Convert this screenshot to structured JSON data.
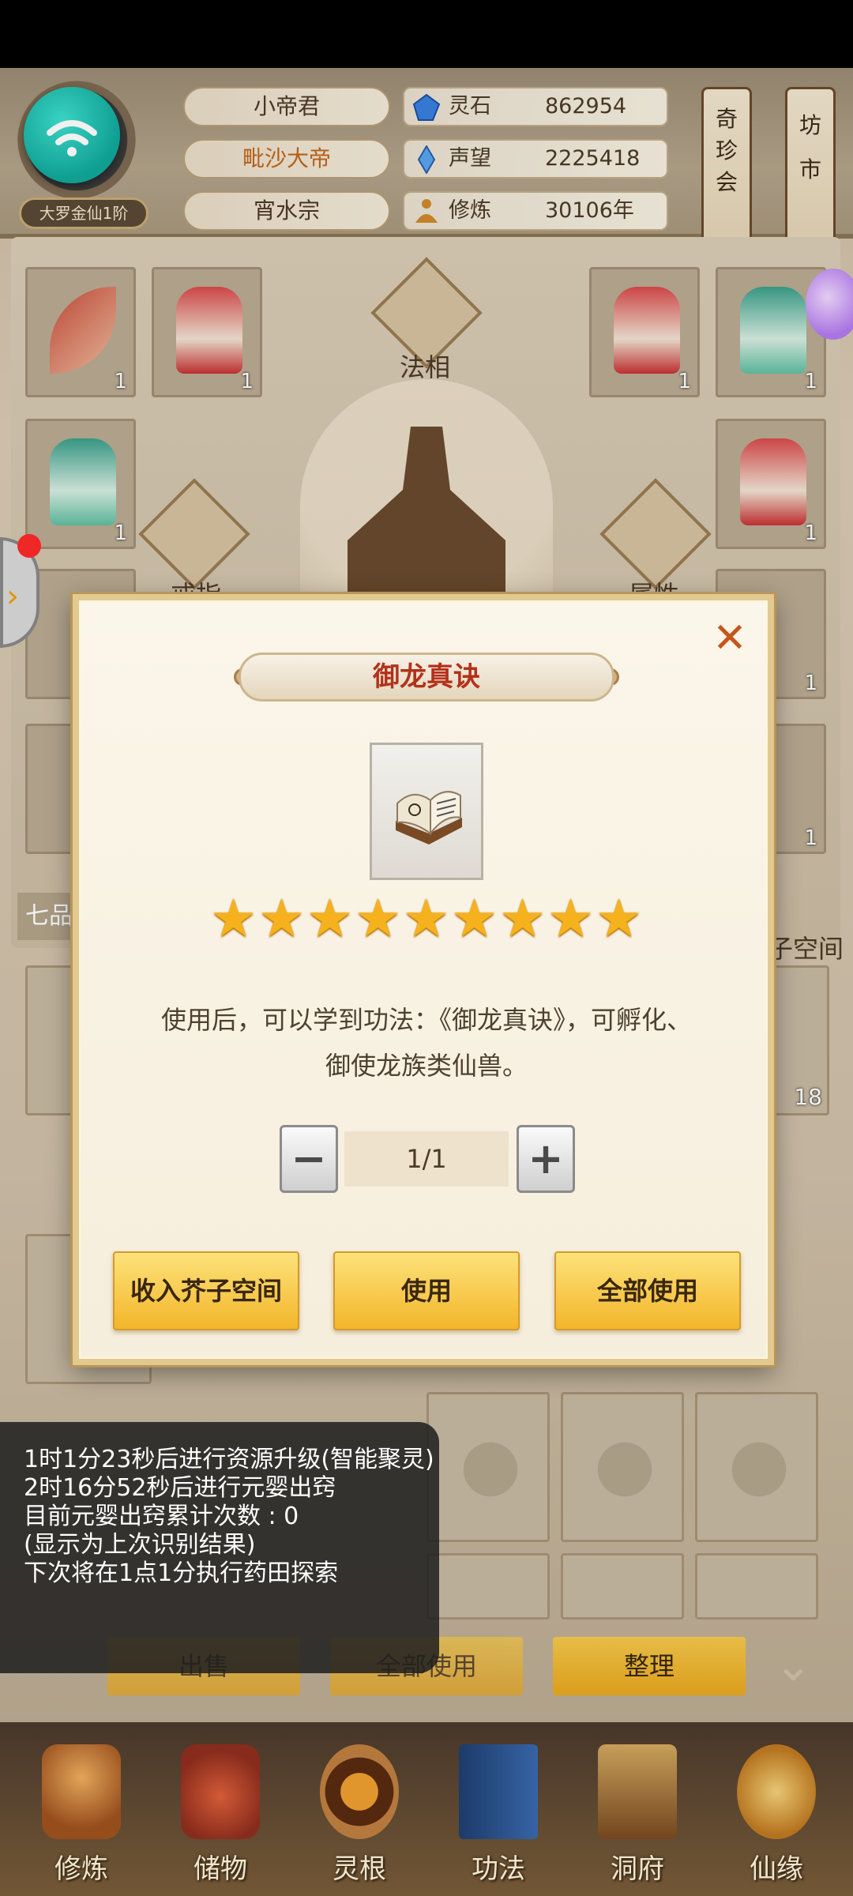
{
  "player": {
    "name": "小帝君",
    "title": "毗沙大帝",
    "sect": "宵水宗",
    "rank": "大罗金仙1阶"
  },
  "resources": [
    {
      "label": "灵石",
      "value": "862954",
      "icon": "spirit-stone-icon"
    },
    {
      "label": "声望",
      "value": "2225418",
      "icon": "reputation-crystal-icon"
    },
    {
      "label": "修炼",
      "value": "30106年",
      "icon": "meditation-icon"
    }
  ],
  "top_buttons": {
    "treasure_fair": "奇珍会",
    "market": "坊市"
  },
  "equipment": {
    "faxiang_label": "法相",
    "ring_label": "戒指",
    "mount_label": "属性",
    "quality_tag": "七品",
    "space_label": "子空间",
    "counts": [
      "1",
      "1",
      "1",
      "1",
      "1",
      "1",
      "1",
      "1",
      "18"
    ]
  },
  "modal": {
    "title": "御龙真诀",
    "stars": 9,
    "description_line1": "使用后，可以学到功法：《御龙真诀》，可孵化、",
    "description_line2": "御使龙族类仙兽。",
    "quantity": "1/1",
    "decrement": "−",
    "increment": "+",
    "close": "✕",
    "buttons": {
      "store": "收入芥子空间",
      "use": "使用",
      "use_all": "全部使用"
    }
  },
  "bag_actions": {
    "sell": "出售",
    "use_all": "全部使用",
    "sort": "整理"
  },
  "log": [
    "1时1分23秒后进行资源升级(智能聚灵)",
    "2时16分52秒后进行元婴出窍",
    "目前元婴出窍累计次数 : 0",
    "(显示为上次识别结果)",
    "下次将在1点1分执行药田探索"
  ],
  "nav": [
    {
      "label": "修炼",
      "icon": "cultivation-icon"
    },
    {
      "label": "储物",
      "icon": "storage-bag-icon"
    },
    {
      "label": "灵根",
      "icon": "spirit-root-icon"
    },
    {
      "label": "功法",
      "icon": "technique-book-icon"
    },
    {
      "label": "洞府",
      "icon": "cave-dwelling-icon"
    },
    {
      "label": "仙缘",
      "icon": "immortal-fate-icon"
    }
  ],
  "colors": {
    "modal_title": "#b3311b",
    "star": "#f6b21c",
    "button_gold": "#f3b62a",
    "wifi_teal": "#10a89a"
  }
}
